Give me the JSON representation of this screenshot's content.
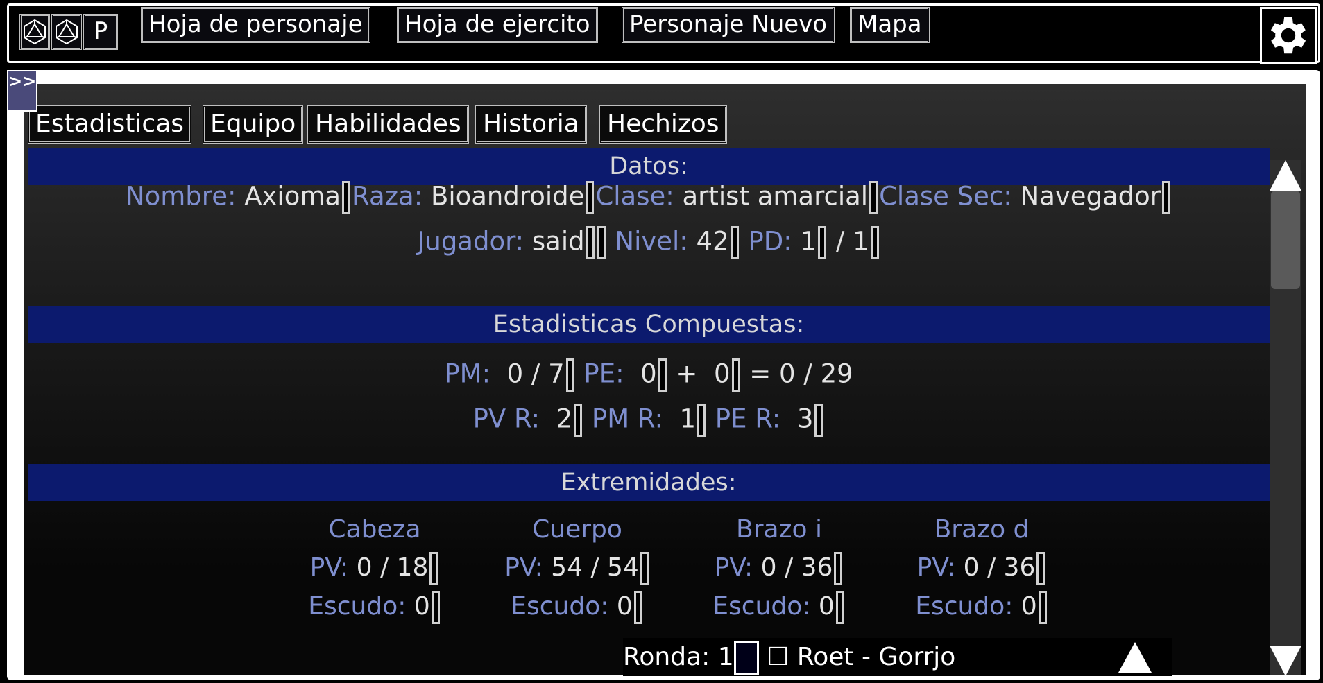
{
  "topbar": {
    "dice_icons": [
      "d20-icon",
      "d20-icon"
    ],
    "p_button": "P",
    "nav": [
      "Hoja de personaje",
      "Hoja de ejercito",
      "Personaje Nuevo",
      "Mapa"
    ]
  },
  "collapse_label": ">>",
  "tabs": [
    "Estadisticas",
    "Equipo",
    "Habilidades",
    "Historia",
    "Hechizos"
  ],
  "datos": {
    "title": "Datos:",
    "nombre_label": "Nombre:",
    "nombre": "Axioma",
    "raza_label": "Raza:",
    "raza": "Bioandroide",
    "clase_label": "Clase:",
    "clase": "artist amarcial",
    "clase_sec_label": "Clase Sec:",
    "clase_sec": "Navegador",
    "jugador_label": "Jugador:",
    "jugador": "said",
    "nivel_label": "Nivel:",
    "nivel": "42",
    "pd_label": "PD:",
    "pd_current": "1",
    "pd_sep": "/",
    "pd_max": "1"
  },
  "compuestas": {
    "title": "Estadisticas Compuestas:",
    "pm_label": "PM:",
    "pm_value": "0 / 7",
    "pe_label": "PE:",
    "pe_a": "0",
    "plus": "+",
    "pe_b": "0",
    "pe_total": "= 0 / 29",
    "pvr_label": "PV R:",
    "pvr": "2",
    "pmr_label": "PM R:",
    "pmr": "1",
    "per_label": "PE R:",
    "per": "3"
  },
  "extremidades": {
    "title": "Extremidades:",
    "pv_label": "PV:",
    "escudo_label": "Escudo:",
    "limbs": [
      {
        "name": "Cabeza",
        "pv": "0 / 18",
        "escudo": "0"
      },
      {
        "name": "Cuerpo",
        "pv": "54 / 54",
        "escudo": "0"
      },
      {
        "name": "Brazo i",
        "pv": "0 / 36",
        "escudo": "0"
      },
      {
        "name": "Brazo d",
        "pv": "0 / 36",
        "escudo": "0"
      }
    ]
  },
  "turn": {
    "ronda_label": "Ronda:",
    "ronda": "1",
    "checkbox": "☐",
    "character": "Roet - Gorrjo"
  },
  "colors": {
    "header_bg": "#0c1a6e",
    "label": "#7f8fd0"
  }
}
